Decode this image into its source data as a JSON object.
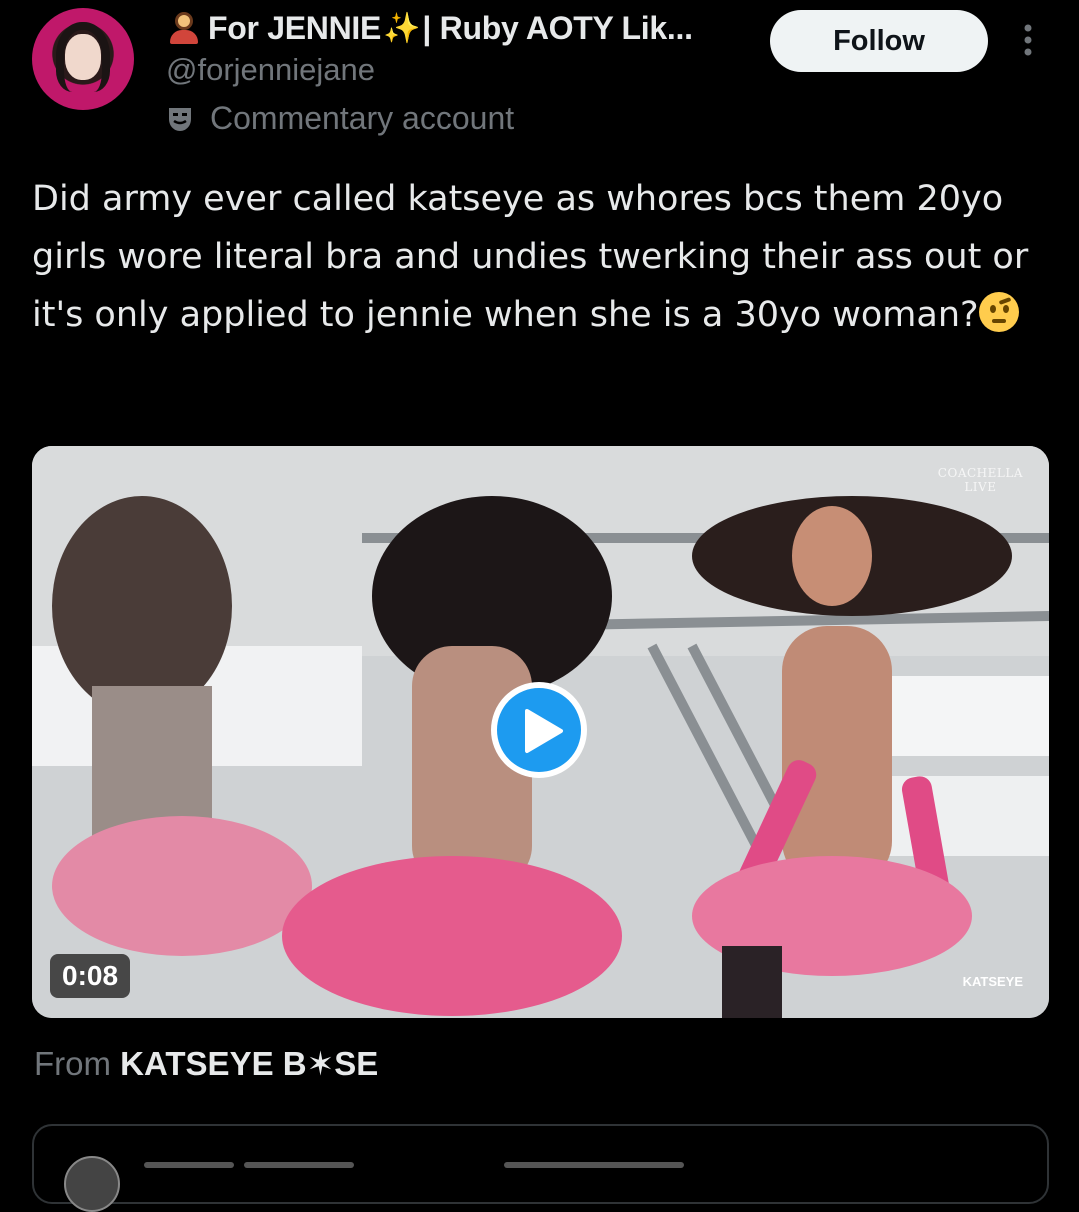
{
  "header": {
    "display_name": "For JENNIE",
    "display_name_suffix": "| Ruby AOTY Lik...",
    "handle": "@forjenniejane",
    "account_label": "Commentary account",
    "follow_label": "Follow"
  },
  "tweet": {
    "text": "Did army ever called katseye as whores bcs them 20yo girls wore literal bra and undies twerking their ass out or it's only applied to jennie when she is a 30yo woman?"
  },
  "media": {
    "duration": "0:08",
    "watermark_top": "COACHELLA",
    "watermark_top_sub": "LIVE",
    "watermark_bottom": "KATSEYE"
  },
  "source": {
    "prefix": "From",
    "name": "KATSEYE B✶SE"
  },
  "icons": {
    "verified_emoji": "person-emoji-icon",
    "sparkle": "sparkles-icon",
    "account_type": "theater-mask-icon",
    "more": "more-vertical-icon",
    "play": "play-icon",
    "thinking": "raised-eyebrow-face-icon"
  },
  "colors": {
    "background": "#000000",
    "text_primary": "#e7e9ea",
    "text_secondary": "#71767b",
    "accent": "#1d9bf0",
    "follow_bg": "#eff3f4"
  }
}
